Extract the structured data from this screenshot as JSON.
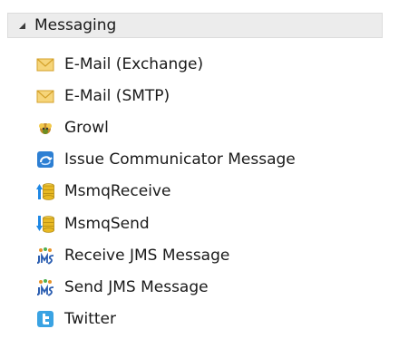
{
  "group": {
    "label": "Messaging",
    "expanded": true
  },
  "items": [
    {
      "label": "E-Mail (Exchange)",
      "icon": "envelope-icon"
    },
    {
      "label": "E-Mail (SMTP)",
      "icon": "envelope-icon"
    },
    {
      "label": "Growl",
      "icon": "growl-icon"
    },
    {
      "label": "Issue Communicator Message",
      "icon": "communicator-icon"
    },
    {
      "label": "MsmqReceive",
      "icon": "msmq-receive-icon"
    },
    {
      "label": "MsmqSend",
      "icon": "msmq-send-icon"
    },
    {
      "label": "Receive JMS Message",
      "icon": "jms-icon"
    },
    {
      "label": "Send JMS Message",
      "icon": "jms-icon"
    },
    {
      "label": "Twitter",
      "icon": "twitter-icon"
    }
  ],
  "colors": {
    "header_background": "#ececec",
    "envelope": "#f2c14e",
    "communicator": "#2d7fd3",
    "msmq_db": "#e8b923",
    "receive_arrow": "#1e88e5",
    "send_arrow": "#1e88e5",
    "jms_text": "#2a5db0",
    "twitter": "#3aa3e3"
  }
}
